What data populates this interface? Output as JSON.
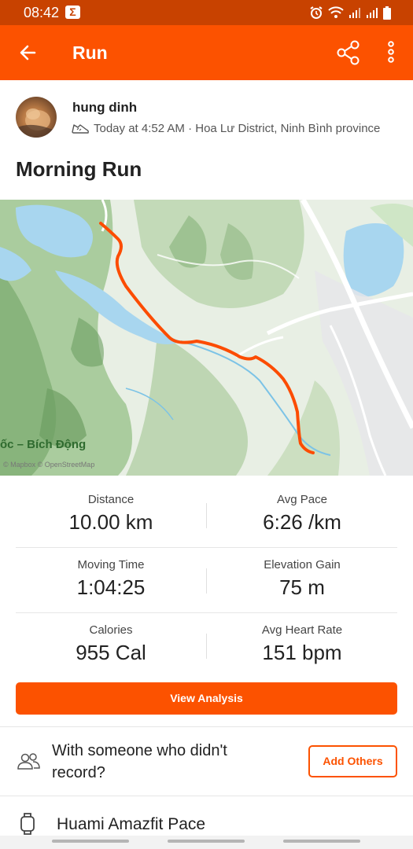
{
  "status_bar": {
    "time": "08:42",
    "app_icon_letter": "Σ",
    "icons": [
      "alarm-icon",
      "wifi-icon",
      "signal-icon",
      "signal-icon",
      "battery-icon"
    ]
  },
  "app_bar": {
    "title": "Run",
    "icons": [
      "back-arrow-icon",
      "share-icon",
      "more-vertical-icon"
    ],
    "accent_color": "#fc5200"
  },
  "activity": {
    "athlete_name": "hung dinh",
    "meta": "Today at 4:52 AM · Hoa Lư District, Ninh Bình province",
    "title": "Morning Run"
  },
  "map": {
    "place_label": "ốc – Bích Động",
    "attribution": "© Mapbox © OpenStreetMap",
    "route_color": "#fc4c02"
  },
  "stats": [
    {
      "left_label": "Distance",
      "left_value": "10.00 km",
      "right_label": "Avg Pace",
      "right_value": "6:26 /km"
    },
    {
      "left_label": "Moving Time",
      "left_value": "1:04:25",
      "right_label": "Elevation Gain",
      "right_value": "75 m"
    },
    {
      "left_label": "Calories",
      "left_value": "955 Cal",
      "right_label": "Avg Heart Rate",
      "right_value": "151 bpm"
    }
  ],
  "actions": {
    "view_analysis": "View Analysis",
    "others_prompt": "With someone who didn't record?",
    "add_others": "Add Others"
  },
  "device": {
    "name": "Huami Amazfit Pace"
  }
}
